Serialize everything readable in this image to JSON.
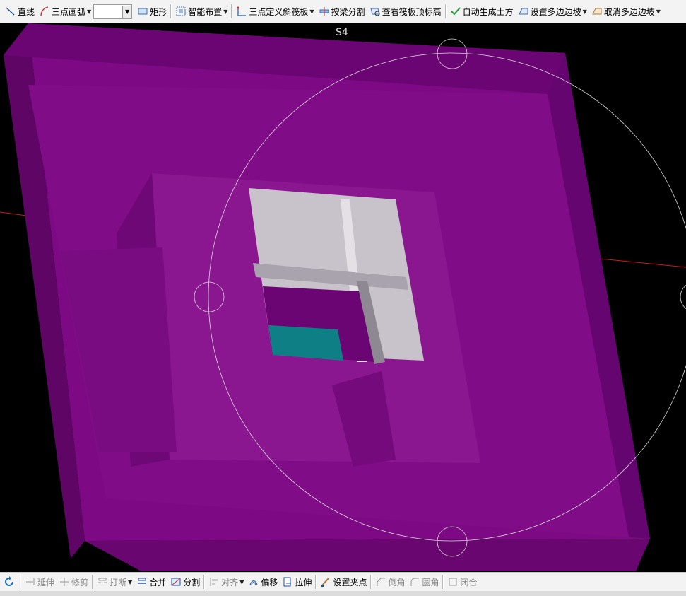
{
  "top_toolbar": {
    "line": "直线",
    "arc": "三点画弧",
    "rect": "矩形",
    "smart_layout": "智能布置",
    "three_point_slope": "三点定义斜筏板",
    "split_by_beam": "按梁分割",
    "view_raft_top": "查看筏板顶标高",
    "auto_earthwork": "自动生成土方",
    "set_multi_slope": "设置多边边坡",
    "cancel_multi_slope": "取消多边边坡"
  },
  "bottom_toolbar": {
    "extend": "延伸",
    "trim": "修剪",
    "break": "打断",
    "merge": "合并",
    "split": "分割",
    "align": "对齐",
    "offset": "偏移",
    "stretch": "拉伸",
    "set_grip": "设置夹点",
    "chamfer": "倒角",
    "fillet": "圆角",
    "close": "闭合"
  },
  "viewport": {
    "orbit_label": "S4",
    "colors": {
      "background": "#000000",
      "slab": "#7d0a84",
      "slab_dark": "#5e0566",
      "slab_light": "#8f1a96",
      "opening": "#c8c2ca",
      "teal": "#0f7f86",
      "axis_red": "#cc1a1a",
      "orbit": "#d8d8d8"
    }
  }
}
